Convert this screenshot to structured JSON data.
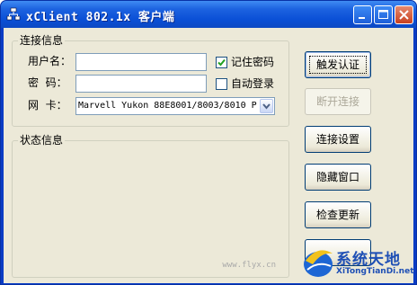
{
  "window": {
    "title": "xClient 802.1x 客户端"
  },
  "login_group": {
    "label": "连接信息",
    "username_label": "用户名：",
    "username_value": "",
    "password_label": "密  码：",
    "password_value": "",
    "nic_label": "网  卡：",
    "nic_value": "Marvell Yukon 88E8001/8003/8010 P",
    "remember_label": "记住密码",
    "remember_checked": true,
    "autologin_label": "自动登录",
    "autologin_checked": false
  },
  "status_group": {
    "label": "状态信息"
  },
  "buttons": {
    "trigger": "触发认证",
    "disconnect": "断开连接",
    "settings": "连接设置",
    "hide": "隐藏窗口",
    "update": "检查更新"
  },
  "watermark": "www.flyx.cn",
  "site_logo": {
    "main": "系统天地",
    "sub": "XiTongTianDi.net"
  }
}
